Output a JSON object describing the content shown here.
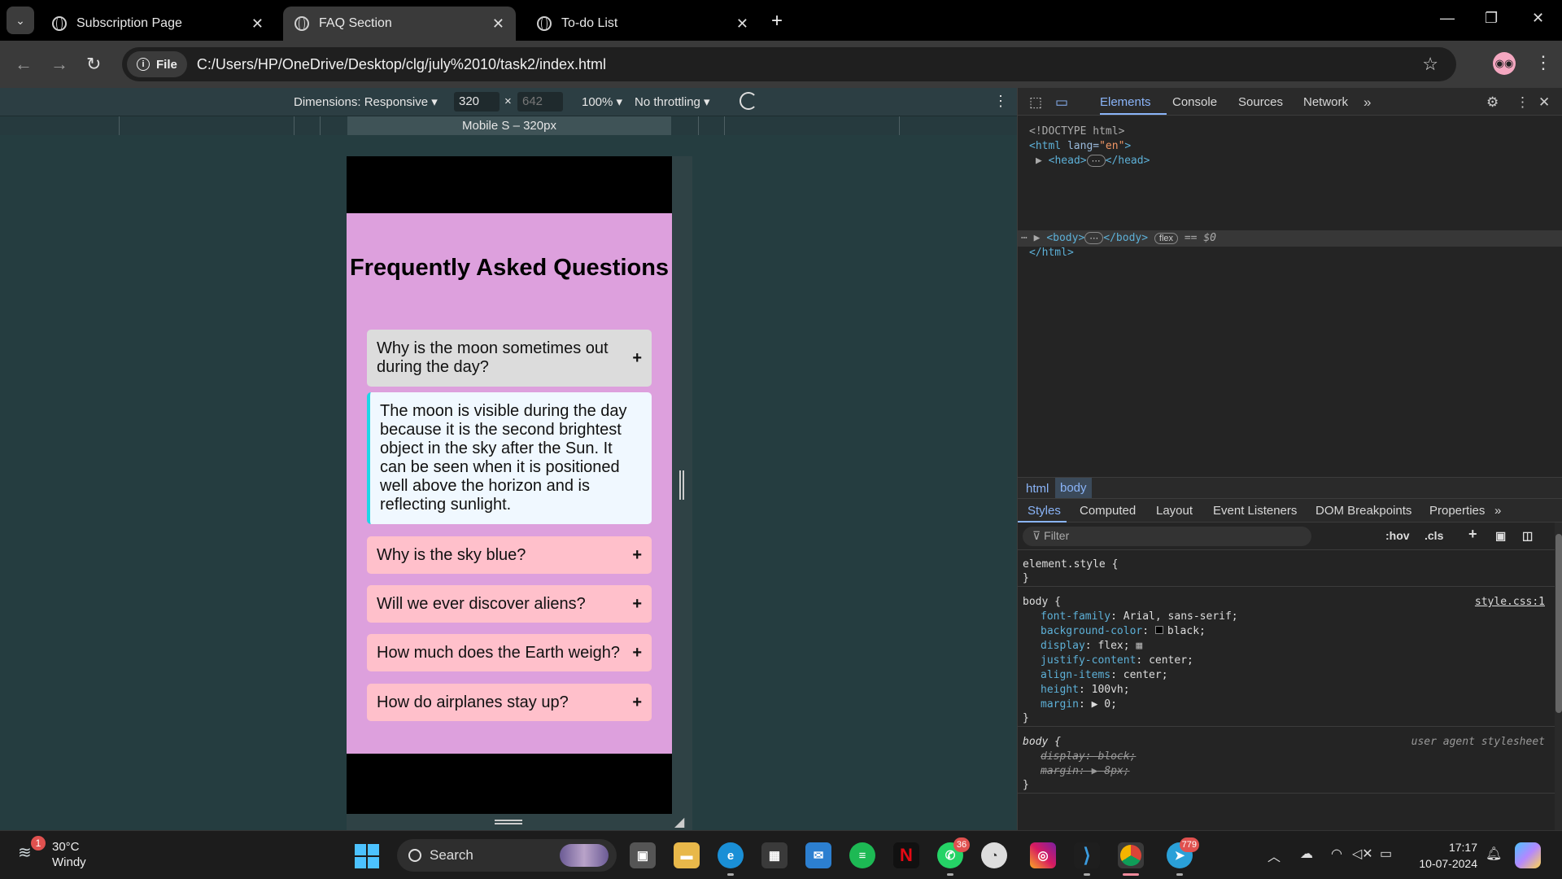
{
  "browser": {
    "tabs": [
      {
        "title": "Subscription Page",
        "active": false
      },
      {
        "title": "FAQ Section",
        "active": true
      },
      {
        "title": "To-do List",
        "active": false
      }
    ],
    "address_chip": "File",
    "url": "C:/Users/HP/OneDrive/Desktop/clg/july%2010/task2/index.html"
  },
  "device_toolbar": {
    "dimensions_label": "Dimensions: Responsive",
    "width": "320",
    "height": "642",
    "times": "×",
    "zoom": "100%",
    "throttling": "No throttling",
    "preset_label": "Mobile S – 320px"
  },
  "faq_page": {
    "title": "Frequently Asked Questions",
    "items": [
      {
        "question": "Why is the moon sometimes out during the day?",
        "icon": "+"
      },
      {
        "question": "Why is the sky blue?",
        "icon": "+"
      },
      {
        "question": "Will we ever discover aliens?",
        "icon": "+"
      },
      {
        "question": "How much does the Earth weigh?",
        "icon": "+"
      },
      {
        "question": "How do airplanes stay up?",
        "icon": "+"
      }
    ],
    "open_answer": "The moon is visible during the day because it is the second brightest object in the sky after the Sun. It can be seen when it is positioned well above the horizon and is reflecting sunlight.",
    "colors": {
      "page_bg": "#dda0dd",
      "item_bg": "#ffc0cb",
      "open_item_bg": "#dcdcdc",
      "answer_bg": "#f0f8ff",
      "answer_border": "#1ed6e6"
    }
  },
  "devtools": {
    "tabs": [
      "Elements",
      "Console",
      "Sources",
      "Network"
    ],
    "dom": {
      "doctype": "<!DOCTYPE html>",
      "html_open": "<html",
      "html_attr": "lang=",
      "html_attr_val": "\"en\"",
      "head_open": "<head>",
      "head_close": "</head>",
      "body_open": "<body>",
      "body_close": "</body>",
      "flex_pill": "flex",
      "eq": "== $0",
      "html_close": "</html>"
    },
    "breadcrumbs": [
      "html",
      "body"
    ],
    "styles_tabs": [
      "Styles",
      "Computed",
      "Layout",
      "Event Listeners",
      "DOM Breakpoints",
      "Properties"
    ],
    "filter_placeholder": "Filter",
    "hov": ":hov",
    "cls": ".cls",
    "element_style": "element.style {",
    "close_brace": "}",
    "body_rule": {
      "selector": "body {",
      "source": "style.css:1",
      "declarations": [
        {
          "prop": "font-family",
          "val": "Arial, sans-serif;"
        },
        {
          "prop": "background-color",
          "val": "black;"
        },
        {
          "prop": "display",
          "val": "flex;"
        },
        {
          "prop": "justify-content",
          "val": "center;"
        },
        {
          "prop": "align-items",
          "val": "center;"
        },
        {
          "prop": "height",
          "val": "100vh;"
        },
        {
          "prop": "margin",
          "val": "0;"
        }
      ]
    },
    "ua_rule": {
      "selector": "body {",
      "source": "user agent stylesheet",
      "declarations": [
        "display: block;",
        "margin: ▶ 8px;"
      ]
    }
  },
  "taskbar": {
    "weather_badge": "1",
    "temperature": "30°C",
    "condition": "Windy",
    "search_label": "Search",
    "whatsapp_badge": "36",
    "telegram_badge": "779",
    "netflix_letter": "N",
    "time": "17:17",
    "date": "10-07-2024"
  }
}
